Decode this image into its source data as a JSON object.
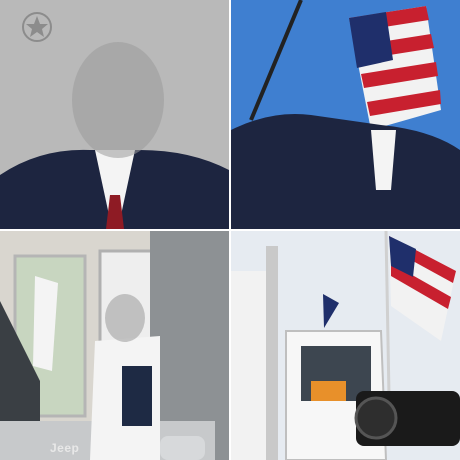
{
  "panels": [
    {
      "id": "top-left"
    },
    {
      "id": "top-right"
    },
    {
      "id": "bottom-left",
      "logo_text": "Jeep"
    },
    {
      "id": "bottom-right"
    }
  ],
  "colors": {
    "grey_backdrop": "#b9b9b9",
    "sky_blue": "#3f7fd0",
    "flag_red": "#c8202f",
    "flag_blue": "#1f2f6b",
    "suit_navy": "#1d2540"
  }
}
